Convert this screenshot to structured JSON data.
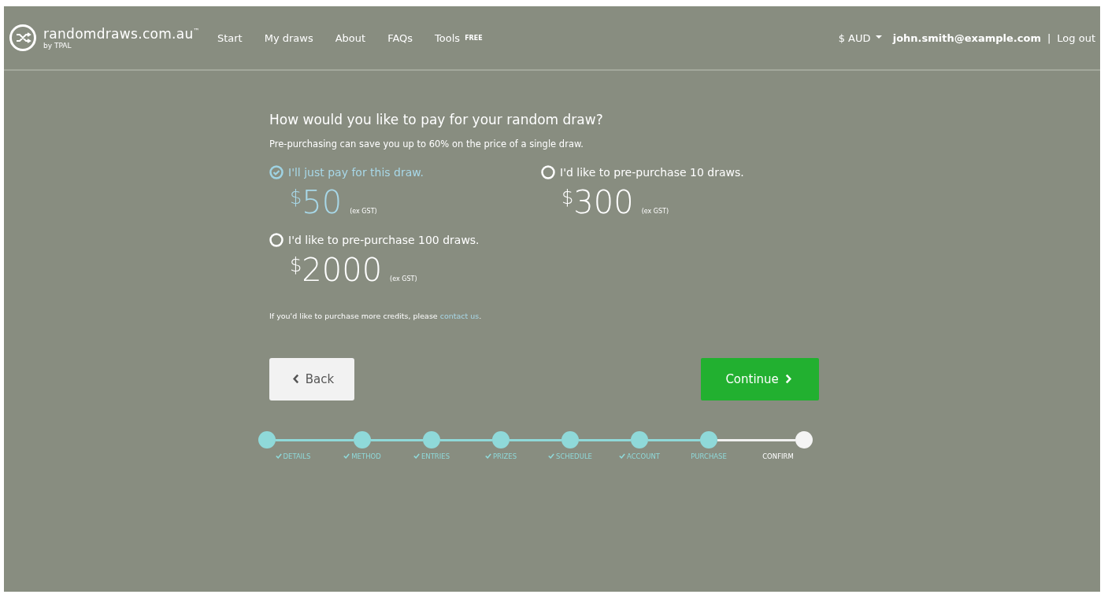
{
  "header": {
    "logo": {
      "name": "randomdraws.com.au",
      "mark": "™",
      "byline": "by TPAL"
    },
    "nav": [
      {
        "label": "Start"
      },
      {
        "label": "My draws"
      },
      {
        "label": "About"
      },
      {
        "label": "FAQs"
      },
      {
        "label": "Tools",
        "badge": "FREE"
      }
    ],
    "currency": "$ AUD",
    "email": "john.smith@example.com",
    "separator": "|",
    "logout": "Log out"
  },
  "heading": "How would you like to pay for your random draw?",
  "subheading": "Pre-purchasing can save you up to 60% on the price of a single draw.",
  "options": [
    {
      "label": "I'll just pay for this draw.",
      "currency": "$",
      "price": "50",
      "note": "(ex GST)",
      "selected": true
    },
    {
      "label": "I'd like to pre-purchase 10 draws.",
      "currency": "$",
      "price": "300",
      "note": "(ex GST)",
      "selected": false
    },
    {
      "label": "I'd like to pre-purchase 100 draws.",
      "currency": "$",
      "price": "2000",
      "note": "(ex GST)",
      "selected": false
    }
  ],
  "contact_text": "If you'd like to purchase more credits, please",
  "contact_link": "contact us",
  "contact_end": ".",
  "back_button": "Back",
  "continue_button": "Continue",
  "steps": [
    {
      "label": "DETAILS",
      "checked": true,
      "selected": false
    },
    {
      "label": "METHOD",
      "checked": true,
      "selected": false
    },
    {
      "label": "ENTRIES",
      "checked": true,
      "selected": false
    },
    {
      "label": "PRIZES",
      "checked": true,
      "selected": false
    },
    {
      "label": "SCHEDULE",
      "checked": true,
      "selected": false
    },
    {
      "label": "ACCOUNT",
      "checked": true,
      "selected": false
    },
    {
      "label": "PURCHASE",
      "checked": false,
      "selected": false
    },
    {
      "label": "CONFIRM",
      "checked": false,
      "selected": true
    }
  ]
}
